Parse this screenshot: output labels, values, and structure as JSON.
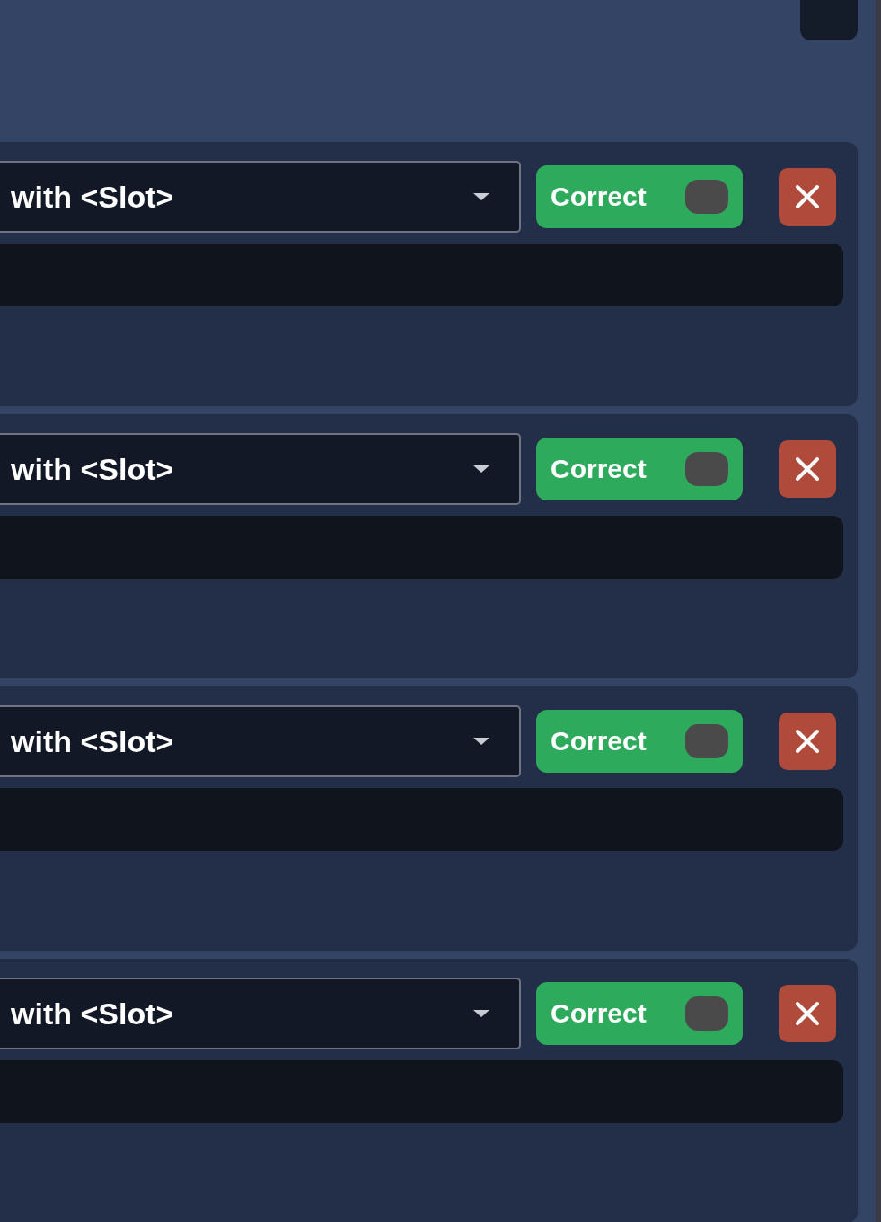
{
  "items": [
    {
      "selection": "with <Slot>",
      "toggle": {
        "label": "Correct",
        "on": false
      }
    },
    {
      "selection": "with <Slot>",
      "toggle": {
        "label": "Correct",
        "on": false
      }
    },
    {
      "selection": "with <Slot>",
      "toggle": {
        "label": "Correct",
        "on": false
      }
    },
    {
      "selection": "with <Slot>",
      "toggle": {
        "label": "Correct",
        "on": false
      }
    }
  ]
}
